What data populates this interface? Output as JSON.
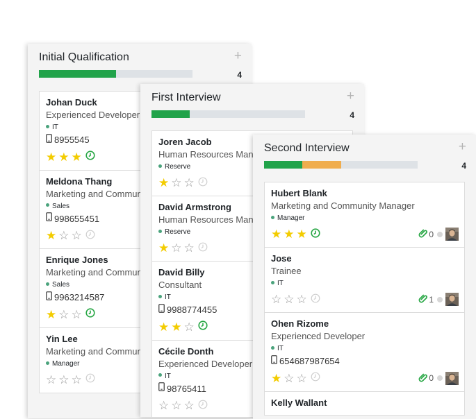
{
  "colors": {
    "green": "#21a34a",
    "orange": "#f0ad4e",
    "star": "#f3cc00",
    "activity": "#28a745"
  },
  "columns": [
    {
      "title": "Initial Qualification",
      "count": "4",
      "progress": [
        {
          "color": "#21a34a",
          "fraction": 0.5
        }
      ],
      "cards": [
        {
          "name": "Johan Duck",
          "job": "Experienced Developer",
          "tag": "IT",
          "phone": "8955545",
          "stars": 3
        },
        {
          "name": "Meldona Thang",
          "job": "Marketing and Community Manager",
          "tag": "Sales",
          "phone": "998655451",
          "stars": 1
        },
        {
          "name": "Enrique Jones",
          "job": "Marketing and Community Manager",
          "tag": "Sales",
          "phone": "9963214587",
          "stars": 1
        },
        {
          "name": "Yin Lee",
          "job": "Marketing and Community Manager",
          "tag": "Manager",
          "phone": "",
          "stars": 0
        }
      ]
    },
    {
      "title": "First Interview",
      "count": "4",
      "progress": [
        {
          "color": "#21a34a",
          "fraction": 0.25
        }
      ],
      "cards": [
        {
          "name": "Joren Jacob",
          "job": "Human Resources Manager",
          "tag": "Reserve",
          "phone": "",
          "stars": 1
        },
        {
          "name": "David Armstrong",
          "job": "Human Resources Manager",
          "tag": "Reserve",
          "phone": "",
          "stars": 1
        },
        {
          "name": "David Billy",
          "job": "Consultant",
          "tag": "IT",
          "phone": "9988774455",
          "stars": 2
        },
        {
          "name": "Cécile Donth",
          "job": "Experienced Developer",
          "tag": "IT",
          "phone": "98765411",
          "stars": 0
        }
      ]
    },
    {
      "title": "Second Interview",
      "count": "4",
      "progress": [
        {
          "color": "#21a34a",
          "fraction": 0.25
        },
        {
          "color": "#f0ad4e",
          "fraction": 0.25
        }
      ],
      "cards": [
        {
          "name": "Hubert Blank",
          "job": "Marketing and Community Manager",
          "tag": "Manager",
          "phone": "",
          "stars": 3,
          "attachments": "0"
        },
        {
          "name": "Jose",
          "job": "Trainee",
          "tag": "IT",
          "phone": "",
          "stars": 0,
          "attachments": "1"
        },
        {
          "name": "Ohen Rizome",
          "job": "Experienced Developer",
          "tag": "IT",
          "phone": "654687987654",
          "stars": 1,
          "attachments": "0"
        },
        {
          "name": "Kelly Wallant",
          "job": "",
          "tag": "",
          "phone": "",
          "stars": 0
        }
      ]
    }
  ],
  "icons": {
    "add": "plus-icon",
    "phone": "mobile-phone-icon",
    "activity": "clock-icon",
    "attachment": "paperclip-icon",
    "status": "kanban-state-dot",
    "avatar": "user-avatar"
  }
}
